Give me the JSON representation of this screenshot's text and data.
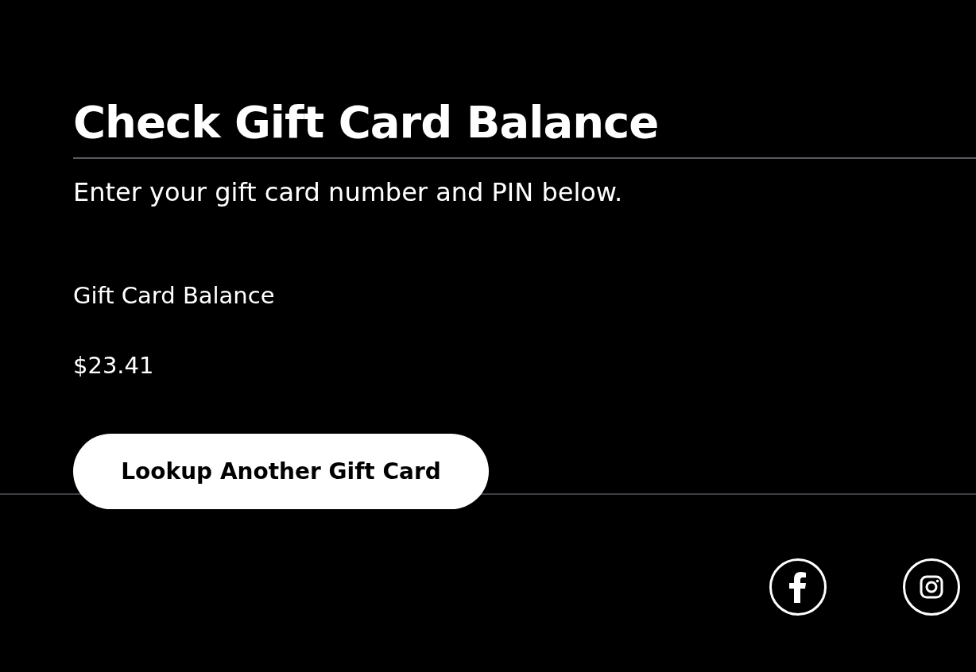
{
  "heading": "Check Gift Card Balance",
  "instructions": "Enter your gift card number and PIN below.",
  "balance": {
    "label": "Gift Card Balance",
    "amount": "$23.41"
  },
  "button": "Lookup Another Gift Card",
  "footer": {
    "social_links": [
      {
        "kind": "facebook"
      },
      {
        "kind": "instagram"
      }
    ]
  }
}
